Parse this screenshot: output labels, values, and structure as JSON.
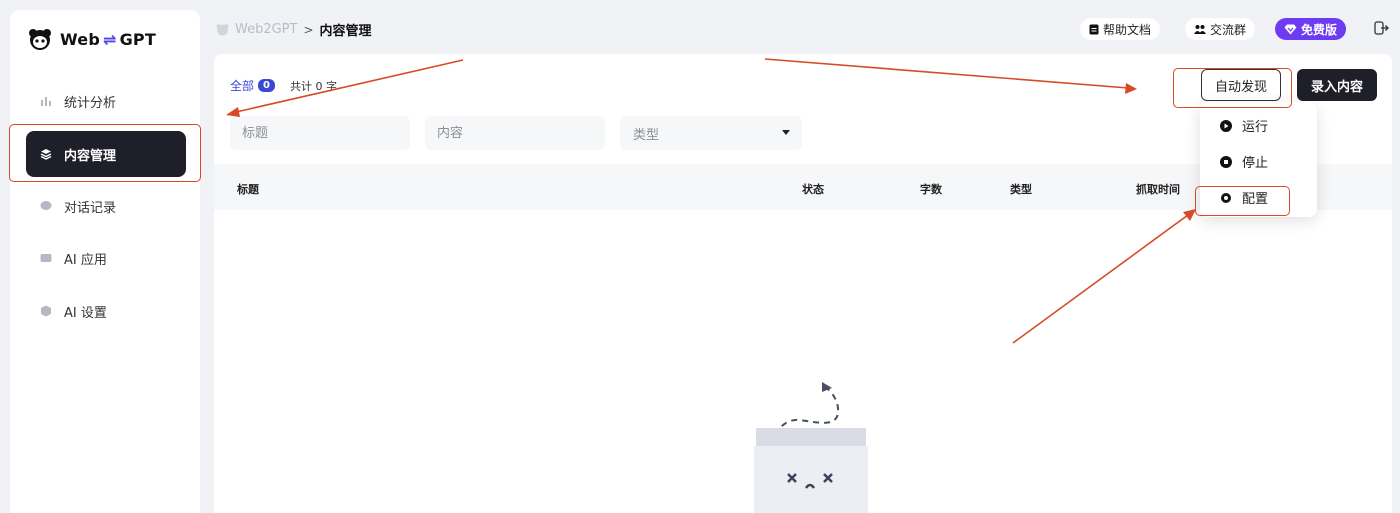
{
  "brand": {
    "name_left": "Web",
    "swap_symbol": "⇌",
    "name_right": "GPT"
  },
  "sidebar": {
    "items": [
      {
        "label": "统计分析",
        "icon": "bar-chart-icon",
        "active": false
      },
      {
        "label": "内容管理",
        "icon": "layers-icon",
        "active": true
      },
      {
        "label": "对话记录",
        "icon": "chat-bubble-icon",
        "active": false
      },
      {
        "label": "AI 应用",
        "icon": "ai-badge-icon",
        "active": false
      },
      {
        "label": "AI 设置",
        "icon": "cube-icon",
        "active": false
      }
    ]
  },
  "breadcrumb": {
    "root": "Web2GPT",
    "separator": ">",
    "current": "内容管理"
  },
  "header": {
    "help_docs": "帮助文档",
    "community": "交流群",
    "plan": "免费版"
  },
  "tabs": {
    "all_label": "全部",
    "all_count": "0",
    "total_label": "共计 0 字"
  },
  "filters": {
    "title_placeholder": "标题",
    "content_placeholder": "内容",
    "type_placeholder": "类型"
  },
  "toolbar": {
    "auto_discover": "自动发现",
    "import_content": "录入内容"
  },
  "table": {
    "columns": [
      "标题",
      "状态",
      "字数",
      "类型",
      "抓取时间"
    ]
  },
  "dropdown": {
    "items": [
      "运行",
      "停止",
      "配置"
    ]
  },
  "colors": {
    "accent": "#3b48d6",
    "dark": "#1e1f29",
    "premium": "#6d3bf2",
    "annotation": "#d64a26"
  }
}
